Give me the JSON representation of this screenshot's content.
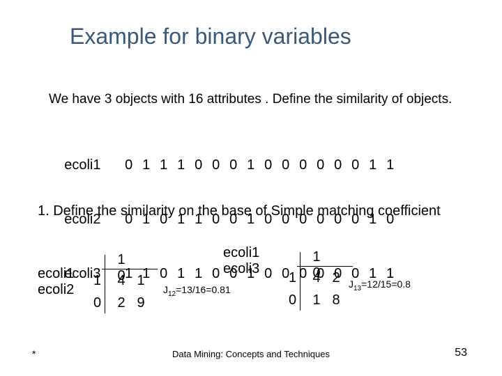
{
  "title": "Example for binary variables",
  "intro": "We have 3 objects with 16 attributes . Define the similarity of  objects.",
  "rows": {
    "r1": {
      "label": "ecoli1",
      "v": [
        "0",
        "1",
        "1",
        "1",
        "0",
        "0",
        "0",
        "1",
        "0",
        "0",
        "0",
        "0",
        "0",
        "0",
        "1",
        "1"
      ]
    },
    "r2": {
      "label": "ecoli2",
      "v": [
        "0",
        "1",
        "0",
        "1",
        "1",
        "0",
        "0",
        "1",
        "0",
        "0",
        "0",
        "0",
        "0",
        "0",
        "1",
        "0"
      ]
    },
    "r3": {
      "label": "ecoli3",
      "v": [
        "1",
        "1",
        "0",
        "1",
        "1",
        "0",
        "0",
        "1",
        "0",
        "0",
        "0",
        "0",
        "0",
        "0",
        "1",
        "1"
      ]
    }
  },
  "step": "1. Define the similarity on the base of Simple matching coefficient",
  "ct1": {
    "pairA": "ecoli1",
    "pairB": "ecoli2",
    "h1": "1",
    "h0": "0",
    "r1": "1",
    "r0": "0",
    "c11": "4",
    "c10": "1",
    "c01": "2",
    "c00": "9",
    "jlabel": "J",
    "jsub": "12",
    "jval": "=13/16=0.81"
  },
  "ct2": {
    "pairA": "ecoli1",
    "pairB": "ecoli3",
    "h1": "1",
    "h0": "0",
    "r1": "1",
    "r0": "0",
    "c11": "4",
    "c10": "2",
    "c01": "1",
    "c00": "8",
    "jlabel": "J",
    "jsub": "13",
    "jval": "=12/15=0.8"
  },
  "footer": {
    "left": "*",
    "center": "Data Mining: Concepts and Techniques",
    "right": "53"
  }
}
